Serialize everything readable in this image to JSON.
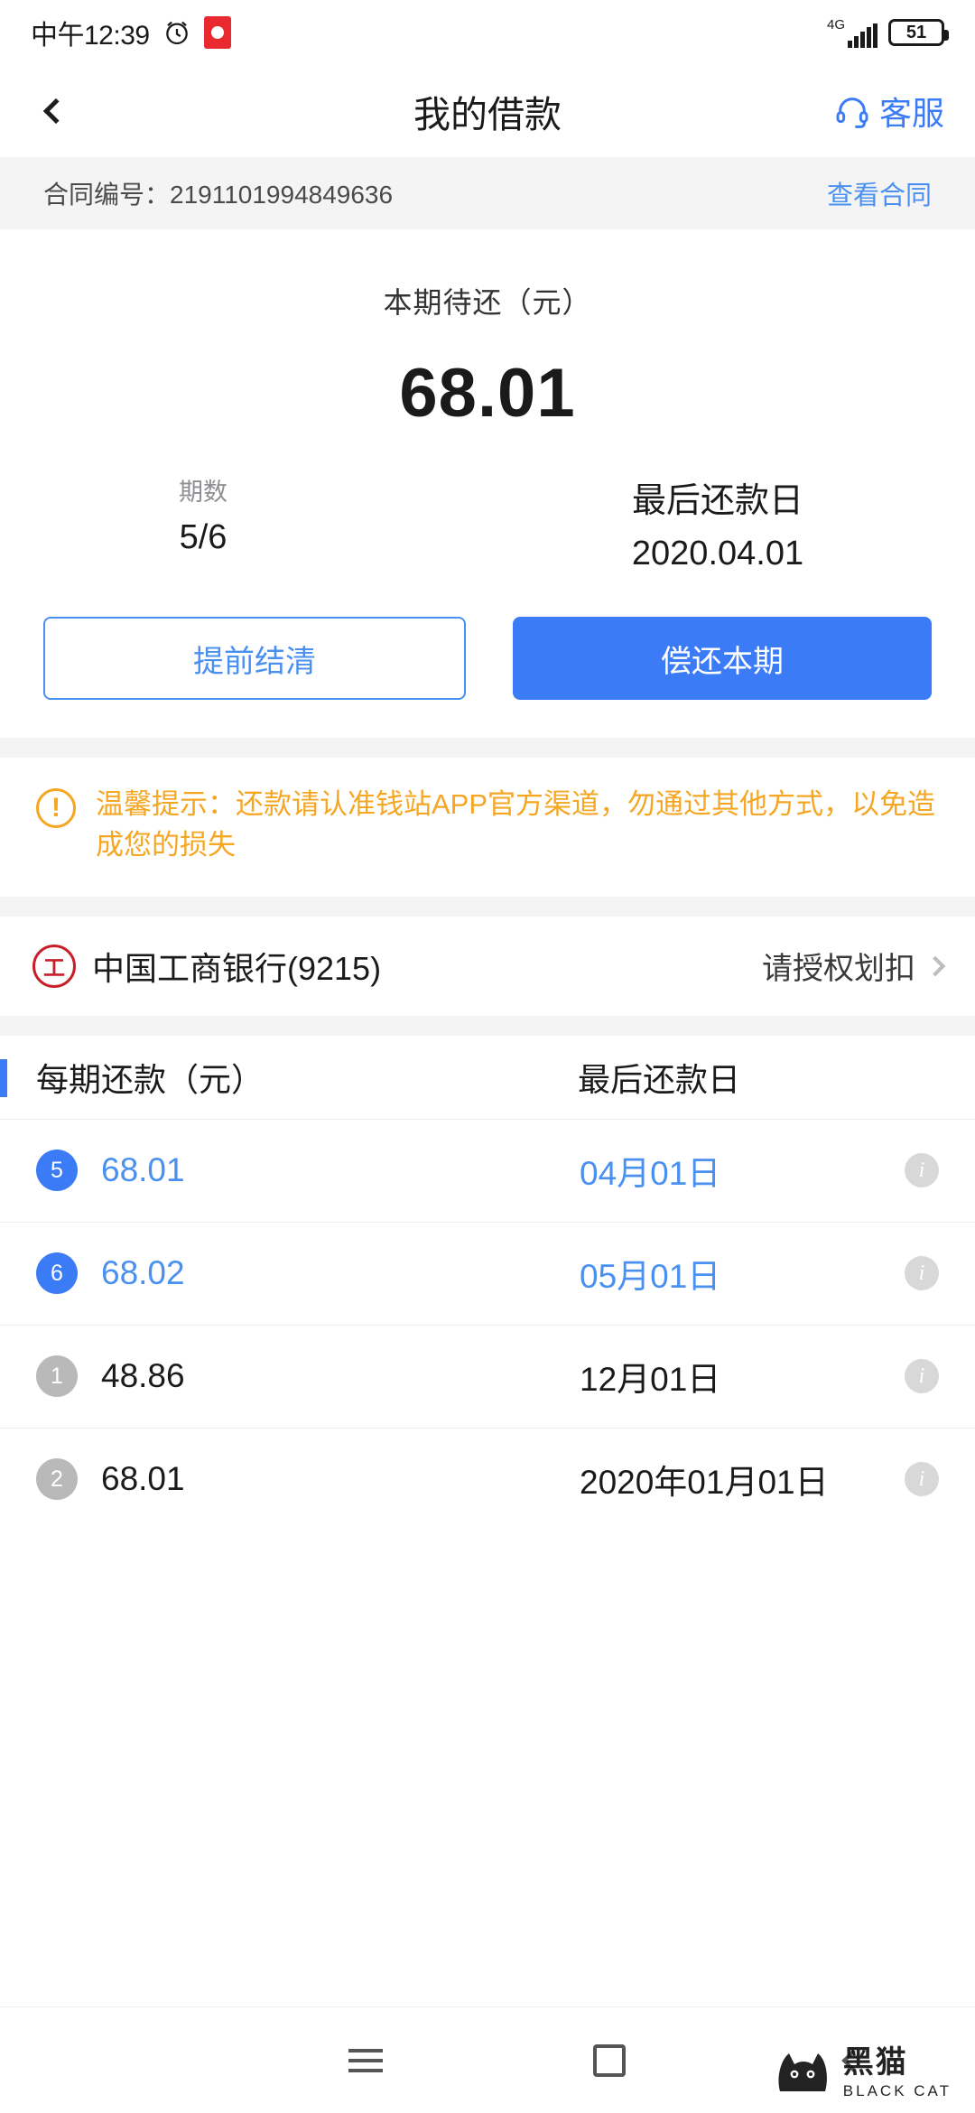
{
  "status_bar": {
    "time": "中午12:39",
    "alarm_icon": "alarm-clock-icon",
    "app_icon": "red-app-icon",
    "network": "4G",
    "battery": "51"
  },
  "nav": {
    "back_icon": "chevron-left-icon",
    "title": "我的借款",
    "support_icon": "headset-icon",
    "support_label": "客服"
  },
  "contract": {
    "label": "合同编号：2191101994849636",
    "link": "查看合同"
  },
  "summary": {
    "amount_label": "本期待还（元）",
    "amount": "68.01",
    "period_label": "期数",
    "period_value": "5/6",
    "due_label": "最后还款日",
    "due_value": "2020.04.01",
    "btn_settle": "提前结清",
    "btn_repay": "偿还本期"
  },
  "warning": {
    "icon": "exclamation-icon",
    "text": "温馨提示：还款请认准钱站APP官方渠道，勿通过其他方式，以免造成您的损失"
  },
  "bank": {
    "icon": "icbc-logo-icon",
    "name": "中国工商银行(9215)",
    "action": "请授权划扣",
    "chevron": "chevron-right-icon"
  },
  "schedule": {
    "col_amount": "每期还款（元）",
    "col_date": "最后还款日",
    "rows": [
      {
        "no": "5",
        "amount": "68.01",
        "date": "04月01日",
        "active": true
      },
      {
        "no": "6",
        "amount": "68.02",
        "date": "05月01日",
        "active": true
      },
      {
        "no": "1",
        "amount": "48.86",
        "date": "12月01日",
        "active": false
      },
      {
        "no": "2",
        "amount": "68.01",
        "date": "2020年01月01日",
        "active": false
      }
    ],
    "info_icon": "info-icon"
  },
  "system_nav": {
    "menu_icon": "menu-icon",
    "home_icon": "home-square-icon",
    "back_icon": "back-chevron-icon"
  },
  "watermark": {
    "logo_icon": "black-cat-icon",
    "cn": "黑猫",
    "en": "BLACK CAT"
  },
  "colors": {
    "accent": "#3b7cf6",
    "link": "#4a90f0",
    "warning": "#f5a623",
    "strip_bg": "#f4f4f4"
  }
}
